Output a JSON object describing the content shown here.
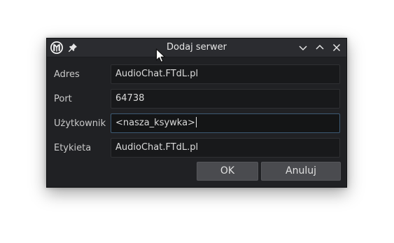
{
  "window": {
    "title": "Dodaj serwer",
    "icons": {
      "app": "mumble-logo-icon",
      "pin": "pin-icon",
      "minimize": "chevron-down-icon",
      "maximize": "chevron-up-icon",
      "close": "close-icon"
    }
  },
  "form": {
    "address": {
      "label": "Adres",
      "value": "AudioChat.FTdL.pl"
    },
    "port": {
      "label": "Port",
      "value": "64738"
    },
    "user": {
      "label": "Użytkownik",
      "value": "<nasza_ksywka>"
    },
    "tag": {
      "label": "Etykieta",
      "value": "AudioChat.FTdL.pl"
    }
  },
  "buttons": {
    "ok": "OK",
    "cancel": "Anuluj"
  },
  "colors": {
    "window_bg": "#202124",
    "titlebar_bg": "#2b2c30",
    "field_bg": "#18191b",
    "focus_border": "#3d5a74",
    "button_bg": "#4a4b4f"
  }
}
